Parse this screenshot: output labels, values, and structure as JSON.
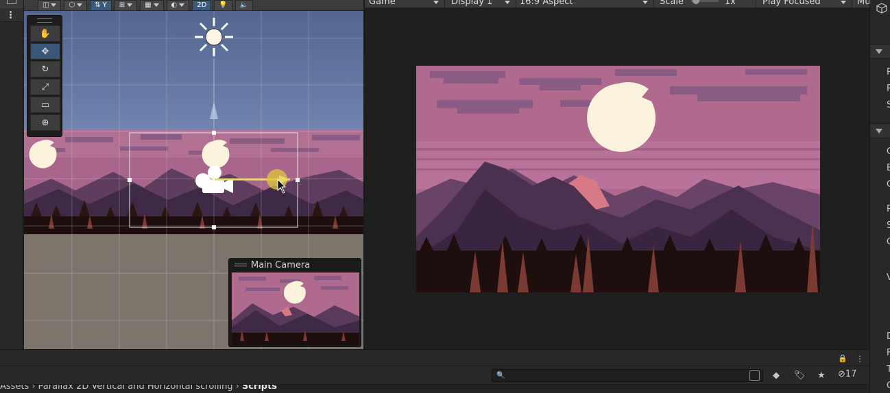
{
  "scene": {
    "toolbar": {
      "mode_2d": "2D",
      "pivot_label": "Y"
    },
    "tools": [
      {
        "name": "hand-tool",
        "icon": "hand-icon",
        "glyph": "✋"
      },
      {
        "name": "move-tool",
        "icon": "move-icon",
        "glyph": "✥"
      },
      {
        "name": "rotate-tool",
        "icon": "rotate-icon",
        "glyph": "↻"
      },
      {
        "name": "scale-tool",
        "icon": "scale-icon",
        "glyph": "⤢"
      },
      {
        "name": "rect-tool",
        "icon": "rect-transform-icon",
        "glyph": "▭"
      },
      {
        "name": "transform-tool",
        "icon": "transform-icon",
        "glyph": "⊕"
      }
    ],
    "camera_preview_title": "Main Camera"
  },
  "game": {
    "tab_label": "Game",
    "display": "Display 1",
    "aspect": "16:9 Aspect",
    "scale_label": "Scale",
    "scale_value": "1x",
    "play_mode": "Play Focused",
    "overflow_label": "Mu"
  },
  "project": {
    "breadcrumb": [
      "Assets",
      "Parallax 2D Vertical and Horizontal scrolling",
      "Scripts"
    ],
    "hidden_count": "17"
  },
  "inspector": {
    "rows": [
      "P",
      "R",
      "S",
      "C",
      "B",
      "C",
      "P",
      "S",
      "C",
      "V",
      "D",
      "F",
      "T",
      "C"
    ]
  },
  "colors": {
    "sky_pink": "#b06a8e",
    "moon": "#fbf2dc",
    "mountain_dark": "#3f2a45",
    "mountain_mid": "#5a3a5c",
    "mountain_highlight": "#d87a86",
    "trees": "#1e0e0e",
    "selection_accent": "#3c5b7a",
    "gizmo_yellow": "#e8d86a"
  }
}
